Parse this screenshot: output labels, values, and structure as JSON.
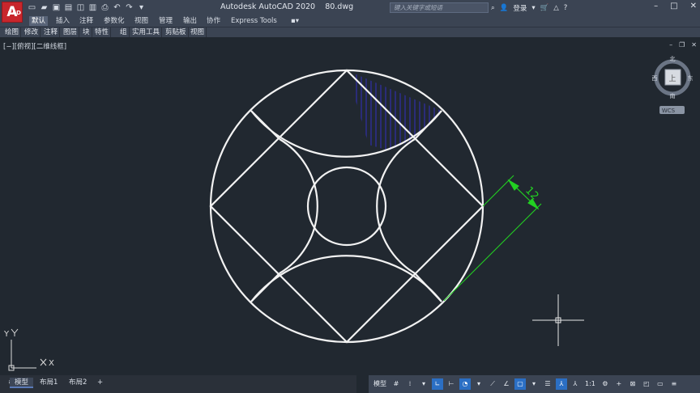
{
  "titlebar": {
    "app": "Autodesk AutoCAD 2020",
    "file": "80.dwg",
    "search_placeholder": "键入关键字或短语",
    "login": "登录",
    "logo_letter": "A",
    "logo_corner": "CAD"
  },
  "tabs": [
    "默认",
    "插入",
    "注释",
    "参数化",
    "视图",
    "管理",
    "输出",
    "协作",
    "Express Tools"
  ],
  "panels": [
    "绘图",
    "修改",
    "注释",
    "图层",
    "块",
    "特性",
    "组",
    "实用工具",
    "剪贴板",
    "视图"
  ],
  "viewport": {
    "label": "[−][俯视][二维线框]"
  },
  "viewcube": {
    "north": "北",
    "east": "东",
    "south": "南",
    "west": "西",
    "face": "上",
    "wcs": "WCS"
  },
  "ucs": {
    "x": "X",
    "y": "Y"
  },
  "dimension": {
    "value": "12"
  },
  "layout_tabs": [
    "模型",
    "布局1",
    "布局2"
  ],
  "status": {
    "model": "模型",
    "scale": "1:1"
  },
  "colors": {
    "background": "#212830",
    "ribbon": "#3b4453",
    "geometry": "#ffffff",
    "dimension": "#00c800",
    "hatch": "#2a2a88",
    "accent": "#2b6fc4"
  }
}
